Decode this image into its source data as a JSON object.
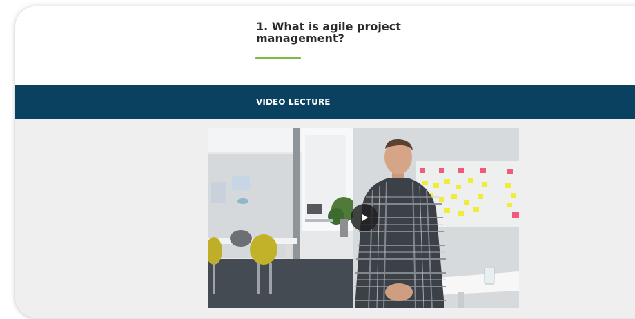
{
  "lesson": {
    "title_line1": "1. What is agile project",
    "title_line2": "management?"
  },
  "section": {
    "label": "VIDEO LECTURE"
  },
  "video": {
    "play_icon": "play-icon"
  },
  "colors": {
    "accent": "#7dbb42",
    "section_bar": "#0a4060",
    "card_bottom": "#efefef"
  }
}
